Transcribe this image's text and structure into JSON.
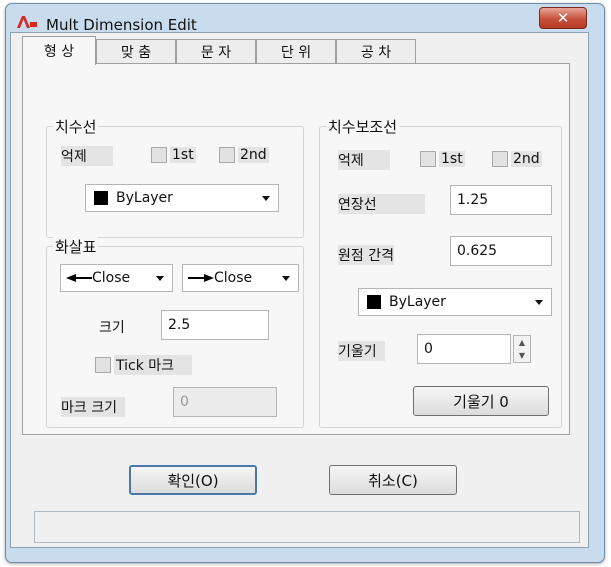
{
  "window": {
    "title": "Mult Dimension Edit",
    "close_glyph": "✕",
    "app_icon": "autocad-a-icon"
  },
  "tabs": [
    {
      "label": "형 상",
      "active": true
    },
    {
      "label": "맞 춤",
      "active": false
    },
    {
      "label": "문 자",
      "active": false
    },
    {
      "label": "단 위",
      "active": false
    },
    {
      "label": "공 차",
      "active": false
    }
  ],
  "dimline": {
    "title": "치수선",
    "suppress_label": "억제",
    "first": "1st",
    "second": "2nd",
    "color": "ByLayer"
  },
  "arrows": {
    "title": "화살표",
    "first": "Close",
    "second": "Close",
    "size_label": "크기",
    "size_value": "2.5",
    "tick_label": "Tick 마크",
    "mark_size_label": "마크 크기",
    "mark_size_value": "0"
  },
  "extline": {
    "title": "치수보조선",
    "suppress_label": "억제",
    "first": "1st",
    "second": "2nd",
    "extension_label": "연장선",
    "extension_value": "1.25",
    "offset_label": "원점 간격",
    "offset_value": "0.625",
    "color": "ByLayer",
    "oblique_label": "기울기",
    "oblique_value": "0",
    "oblique_button": "기울기 0"
  },
  "buttons": {
    "ok": "확인(O)",
    "cancel": "취소(C)"
  }
}
